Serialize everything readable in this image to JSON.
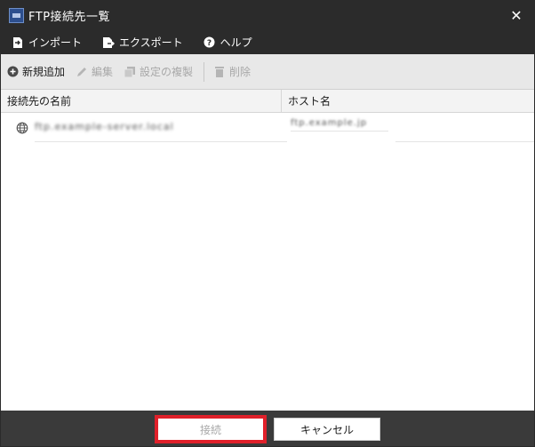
{
  "window": {
    "title": "FTP接続先一覧",
    "close_glyph": "✕"
  },
  "menu": {
    "items": [
      {
        "label": "インポート",
        "icon": "import-icon"
      },
      {
        "label": "エクスポート",
        "icon": "export-icon"
      },
      {
        "label": "ヘルプ",
        "icon": "help-icon"
      }
    ]
  },
  "toolbar": {
    "new_label": "新規追加",
    "edit_label": "編集",
    "duplicate_label": "設定の複製",
    "delete_label": "削除"
  },
  "table": {
    "columns": [
      "接続先の名前",
      "ホスト名"
    ],
    "rows": [
      {
        "name": "ftp.example-server.local",
        "host": "ftp.example.jp"
      }
    ]
  },
  "footer": {
    "connect_label": "接続",
    "cancel_label": "キャンセル"
  },
  "colors": {
    "titlebar": "#2b2b2b",
    "highlight": "#e0202a",
    "disabled": "#a8a8a8"
  }
}
